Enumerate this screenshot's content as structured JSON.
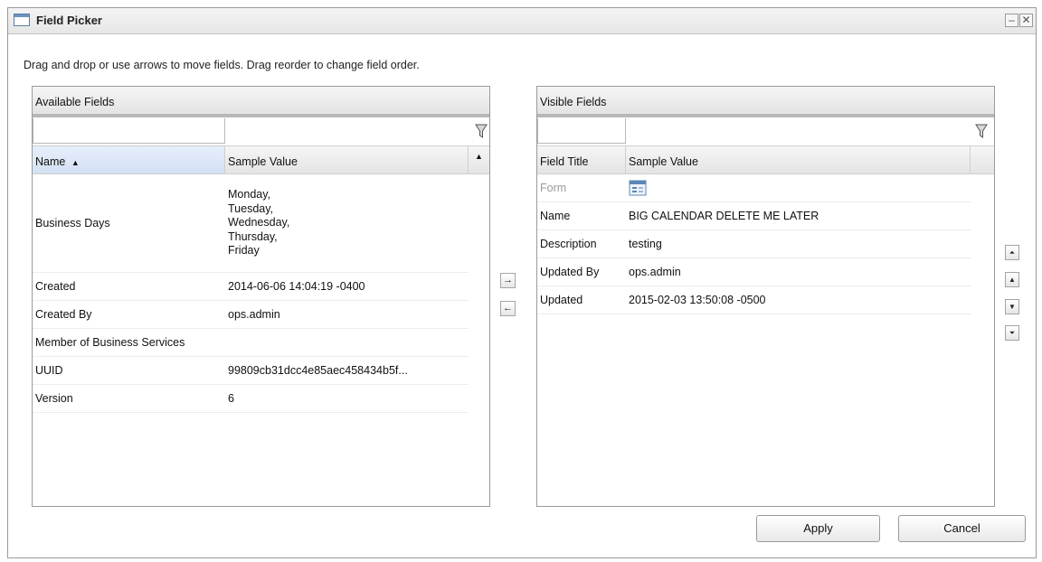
{
  "window": {
    "title": "Field Picker",
    "minimize_glyph": "–",
    "close_glyph": "✕"
  },
  "instructions": "Drag and drop or use arrows to move fields. Drag reorder to change field order.",
  "available": {
    "header": "Available Fields",
    "col_name": "Name",
    "col_sample": "Sample Value",
    "sort_indicator": "▲",
    "rows": [
      {
        "name": "Business Days",
        "sample": "Monday,\nTuesday,\nWednesday,\nThursday,\nFriday"
      },
      {
        "name": "Created",
        "sample": "2014-06-06 14:04:19 -0400"
      },
      {
        "name": "Created By",
        "sample": "ops.admin"
      },
      {
        "name": "Member of Business Services",
        "sample": ""
      },
      {
        "name": "UUID",
        "sample": "99809cb31dcc4e85aec458434b5f..."
      },
      {
        "name": "Version",
        "sample": "6"
      }
    ]
  },
  "visible": {
    "header": "Visible Fields",
    "col_title": "Field Title",
    "col_sample": "Sample Value",
    "rows": [
      {
        "title": "Form",
        "sample": "",
        "icon": "form-icon"
      },
      {
        "title": "Name",
        "sample": "BIG CALENDAR DELETE ME LATER"
      },
      {
        "title": "Description",
        "sample": "testing"
      },
      {
        "title": "Updated By",
        "sample": "ops.admin"
      },
      {
        "title": "Updated",
        "sample": "2015-02-03 13:50:08 -0500"
      }
    ]
  },
  "move": {
    "right_glyph": "→",
    "left_glyph": "←"
  },
  "order": {
    "top_glyph": "⏶",
    "up_glyph": "▲",
    "down_glyph": "▼",
    "bottom_glyph": "⏷"
  },
  "buttons": {
    "apply": "Apply",
    "cancel": "Cancel"
  },
  "colors": {
    "accent": "#6b92c0",
    "header_border": "#b8b8b8"
  }
}
